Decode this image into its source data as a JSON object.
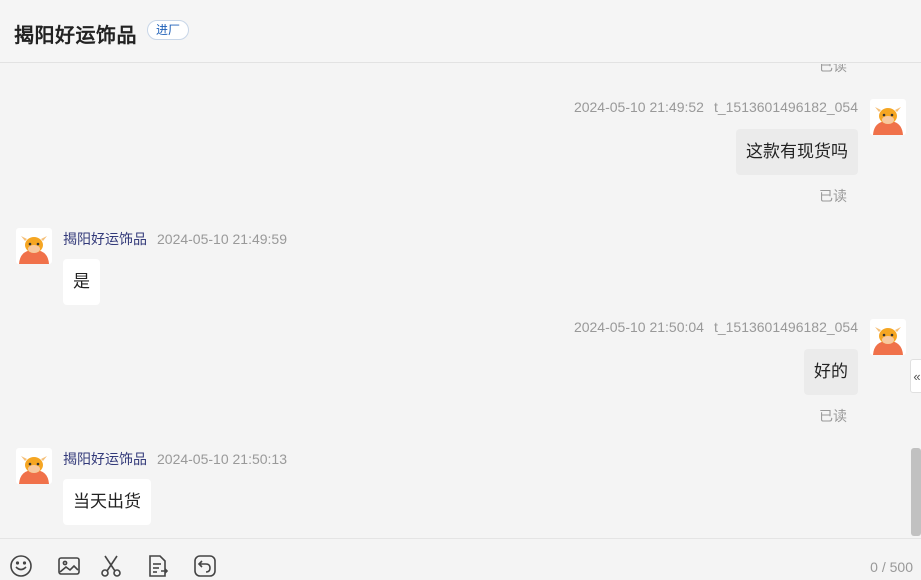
{
  "header": {
    "shop_name": "揭阳好运饰品",
    "tag": "进厂"
  },
  "messages": {
    "read_top": "已读",
    "m1": {
      "time": "2024-05-10 21:49:52",
      "uid": "t_1513601496182_054",
      "text": "这款有现货吗",
      "read": "已读"
    },
    "m2": {
      "sender": "揭阳好运饰品",
      "time": "2024-05-10 21:49:59",
      "text": "是"
    },
    "m3": {
      "time": "2024-05-10 21:50:04",
      "uid": "t_1513601496182_054",
      "text": "好的",
      "read": "已读"
    },
    "m4": {
      "sender": "揭阳好运饰品",
      "time": "2024-05-10 21:50:13",
      "text": "当天出货"
    }
  },
  "side": {
    "collapse_icon": "«"
  },
  "toolbar": {
    "icons": [
      "emoji-icon",
      "image-icon",
      "scissors-icon",
      "file-icon",
      "undo-icon"
    ],
    "counter": "0 / 500"
  },
  "colors": {
    "background": "#f4f4f4",
    "sender_name": "#333a7a",
    "tag_text": "#1d5fb8",
    "avatar": "#f0714a"
  }
}
